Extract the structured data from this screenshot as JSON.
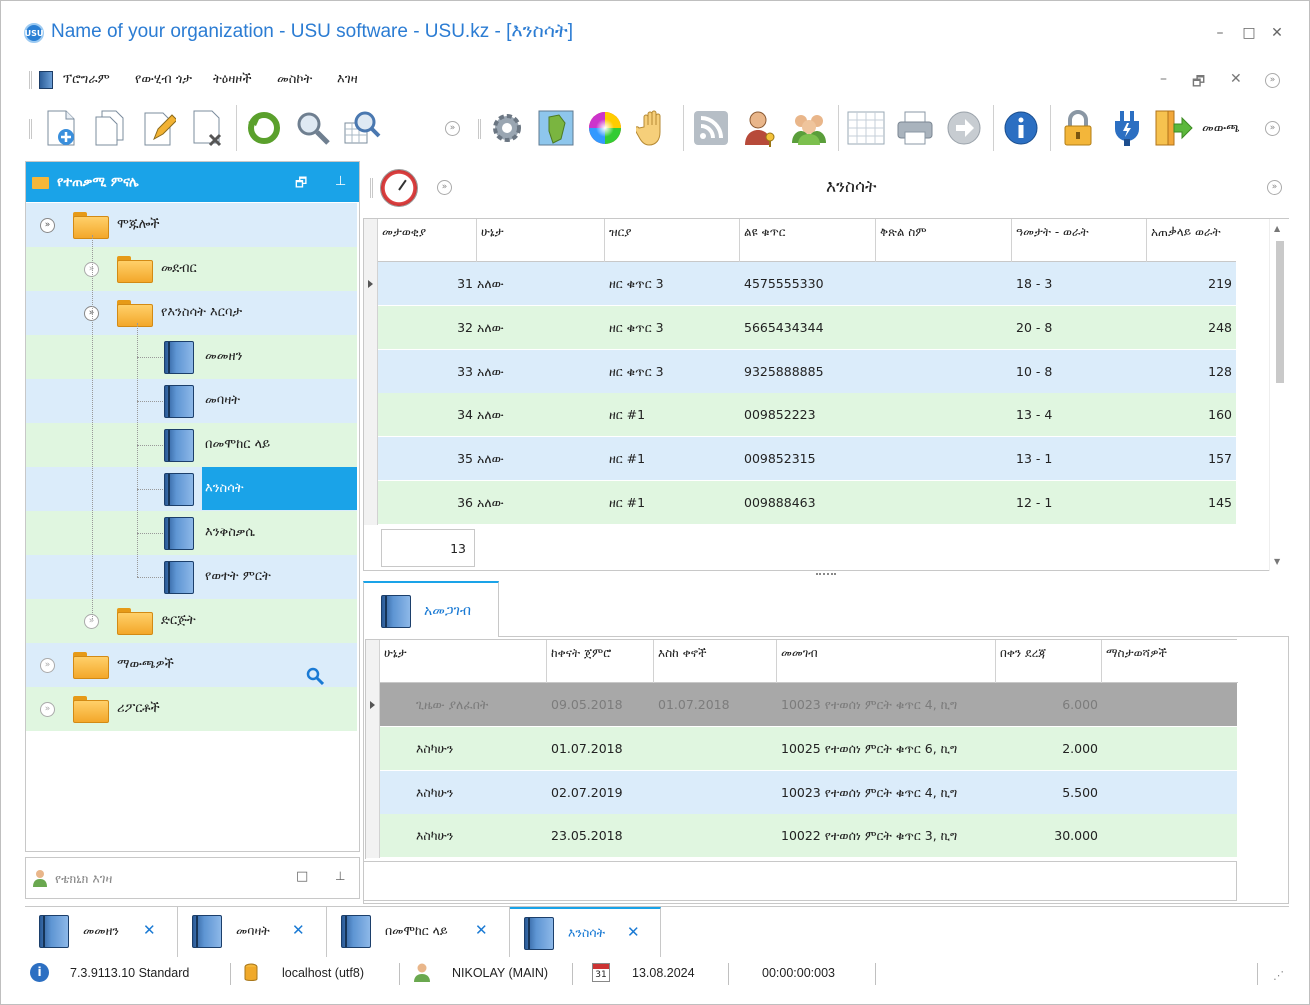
{
  "window": {
    "title": "Name of your organization - USU software - USU.kz - [እንስሳት]",
    "logo_text": "USU",
    "minimize": "–",
    "maximize": "□",
    "close": "✕"
  },
  "menu": {
    "items": [
      "ፕሮግራም",
      "የውሂብ ጎታ",
      "ትዕዛዞች",
      "መስኮት",
      "እገዛ"
    ],
    "mdi_min": "–",
    "mdi_restore": "🗗",
    "mdi_close": "✕"
  },
  "toolbar": {
    "exit_label": "መውጫ"
  },
  "nav": {
    "header": "የተጠቃሚ ምናሌ",
    "items": [
      {
        "label": "ሞጁሎች"
      },
      {
        "label": "መደብር"
      },
      {
        "label": "የእንስሳት እርባታ"
      },
      {
        "label": "መመዘን"
      },
      {
        "label": "መባዛት"
      },
      {
        "label": "በመሞከር ላይ"
      },
      {
        "label": "እንስሳት"
      },
      {
        "label": "እንቅስቃሴ"
      },
      {
        "label": "የወተት ምርት"
      },
      {
        "label": "ድርጅት"
      },
      {
        "label": "ማውጫዎች"
      },
      {
        "label": "ሪፖርቶች"
      }
    ],
    "tech_panel": "የቴክኒክ እገዛ"
  },
  "content": {
    "title": "እንስሳት"
  },
  "animals_grid": {
    "columns": [
      "መታወቂያ",
      "ሁኔታ",
      "ዝርያ",
      "ልዩ ቁጥር",
      "ቅጽል ስም",
      "ዓመታት - ወራት",
      "አጠቃላይ ወራት"
    ],
    "rows": [
      {
        "id": "31",
        "status": "አለው",
        "breed": "ዘር ቁጥር 3",
        "number": "4575555330",
        "nickname": "",
        "age": "18 - 3",
        "months": "219"
      },
      {
        "id": "32",
        "status": "አለው",
        "breed": "ዘር ቁጥር 3",
        "number": "5665434344",
        "nickname": "",
        "age": "20 - 8",
        "months": "248"
      },
      {
        "id": "33",
        "status": "አለው",
        "breed": "ዘር ቁጥር 3",
        "number": "9325888885",
        "nickname": "",
        "age": "10 - 8",
        "months": "128"
      },
      {
        "id": "34",
        "status": "አለው",
        "breed": "ዘር #1",
        "number": "009852223",
        "nickname": "",
        "age": "13 - 4",
        "months": "160"
      },
      {
        "id": "35",
        "status": "አለው",
        "breed": "ዘር #1",
        "number": "009852315",
        "nickname": "",
        "age": "13 - 1",
        "months": "157"
      },
      {
        "id": "36",
        "status": "አለው",
        "breed": "ዘር #1",
        "number": "009888463",
        "nickname": "",
        "age": "12 - 1",
        "months": "145"
      }
    ],
    "count": "13"
  },
  "detail_tab": {
    "label": "አመጋገብ"
  },
  "feeding_grid": {
    "columns": [
      "ሁኔታ",
      "ከቀናት ጀምሮ",
      "እስከ ቀኖች",
      "መመገብ",
      "በቀን ደረጃ",
      "ማስታወሻዎች"
    ],
    "rows": [
      {
        "status": "ጊዜው ያለፈበት",
        "from": "09.05.2018",
        "to": "01.07.2018",
        "feed": "10023 የተወሰነ ምርት ቁጥር 4, ኪግ",
        "rate": "6.000",
        "notes": ""
      },
      {
        "status": "እስካሁን",
        "from": "01.07.2018",
        "to": "",
        "feed": "10025 የተወሰነ ምርት ቁጥር 6, ኪግ",
        "rate": "2.000",
        "notes": ""
      },
      {
        "status": "እስካሁን",
        "from": "02.07.2019",
        "to": "",
        "feed": "10023 የተወሰነ ምርት ቁጥር 4, ኪግ",
        "rate": "5.500",
        "notes": ""
      },
      {
        "status": "እስካሁን",
        "from": "23.05.2018",
        "to": "",
        "feed": "10022 የተወሰነ ምርት ቁጥር 3, ኪግ",
        "rate": "30.000",
        "notes": ""
      }
    ]
  },
  "doc_tabs": [
    {
      "label": "መመዘን"
    },
    {
      "label": "መባዛት"
    },
    {
      "label": "በመሞከር ላይ"
    },
    {
      "label": "እንስሳት"
    }
  ],
  "status": {
    "version": "7.3.9113.10 Standard",
    "db": "localhost (utf8)",
    "user": "NIKOLAY (MAIN)",
    "calendar_day": "31",
    "date": "13.08.2024",
    "timer": "00:00:00:003"
  },
  "colors": {
    "accent": "#1aa3e8",
    "row_blue": "#dbecfa",
    "row_green": "#e0f6e0",
    "row_expired": "#a8a8a8"
  }
}
